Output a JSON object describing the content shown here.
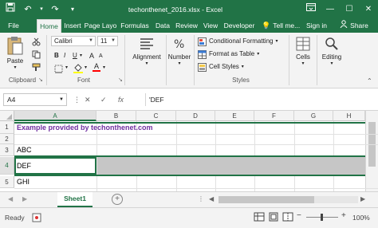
{
  "app": {
    "title": "techonthenet_2016.xlsx - Excel",
    "accent_color": "#217346"
  },
  "quick_access": {
    "icons": [
      "save-icon",
      "undo-icon",
      "redo-icon",
      "customize-icon"
    ]
  },
  "window_controls": {
    "icons": [
      "ribbon-display-icon",
      "minimize-icon",
      "maximize-icon",
      "close-icon"
    ]
  },
  "tabs": [
    "File",
    "Home",
    "Insert",
    "Page Layo",
    "Formulas",
    "Data",
    "Review",
    "View",
    "Developer"
  ],
  "tell_me": "Tell me...",
  "sign_in": "Sign in",
  "share": "Share",
  "ribbon": {
    "clipboard": {
      "paste": "Paste",
      "label": "Clipboard"
    },
    "font": {
      "name": "Calibri",
      "size": "11",
      "bold": "B",
      "italic": "I",
      "underline": "U",
      "grow": "A",
      "shrink": "A",
      "font_color": "A",
      "label": "Font"
    },
    "alignment": {
      "label": "Alignment"
    },
    "number": {
      "label": "Number"
    },
    "styles": {
      "conditional": "Conditional Formatting",
      "format_table": "Format as Table",
      "cell_styles": "Cell Styles",
      "label": "Styles"
    },
    "cells": {
      "label": "Cells"
    },
    "editing": {
      "label": "Editing"
    }
  },
  "formula_bar": {
    "name_box": "A4",
    "fx": "fx",
    "formula": "'DEF"
  },
  "grid": {
    "columns": [
      "A",
      "B",
      "C",
      "D",
      "E",
      "F",
      "G",
      "H"
    ],
    "rows": [
      {
        "num": "1",
        "text": "Example provided by techonthenet.com",
        "purple": true
      },
      {
        "num": "2",
        "text": ""
      },
      {
        "num": "3",
        "text": "ABC"
      },
      {
        "num": "4",
        "text": "DEF"
      },
      {
        "num": "5",
        "text": "GHI"
      }
    ]
  },
  "sheets": [
    "Sheet1"
  ],
  "status": {
    "ready": "Ready",
    "zoom": "100%"
  }
}
